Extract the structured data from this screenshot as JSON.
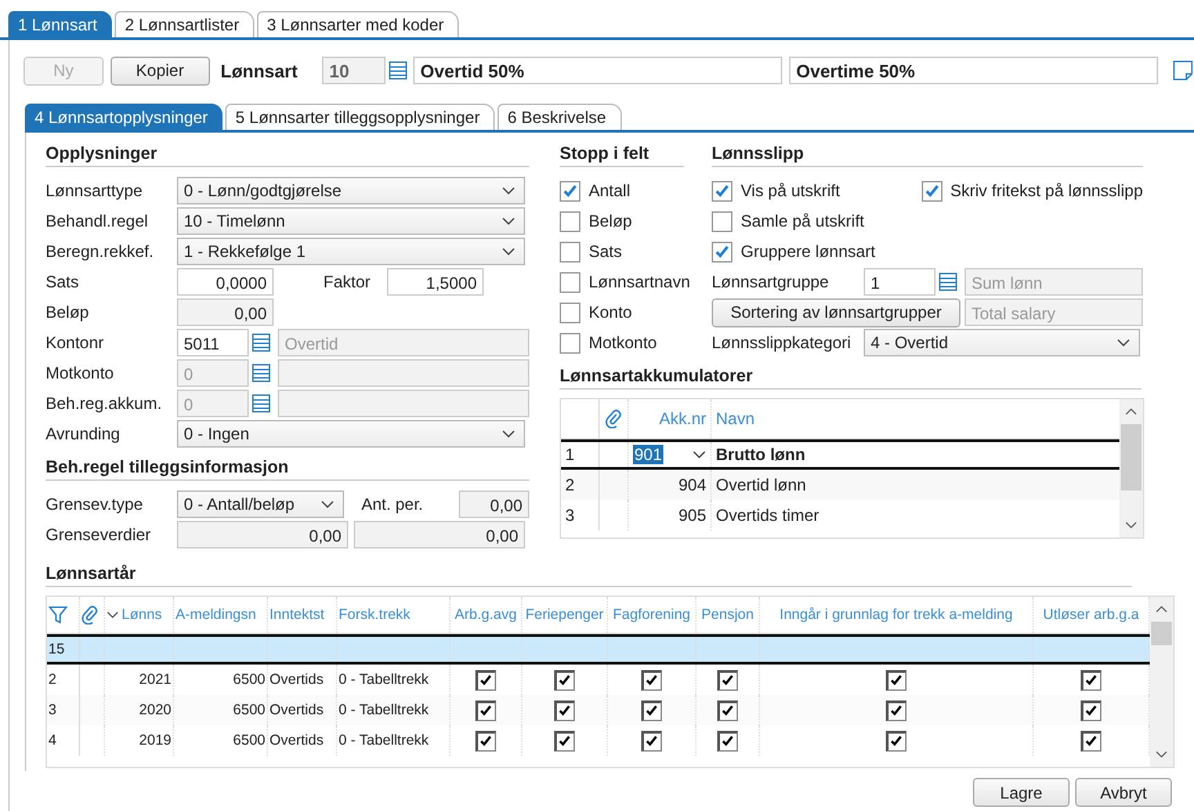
{
  "top_tabs": [
    {
      "label": "1 Lønnsart",
      "selected": true
    },
    {
      "label": "2 Lønnsartlister",
      "selected": false
    },
    {
      "label": "3 Lønnsarter med koder",
      "selected": false
    }
  ],
  "toolbar": {
    "buttons": [
      {
        "label": "Ny",
        "disabled": true
      },
      {
        "label": "Kopier",
        "disabled": false
      }
    ],
    "label": "Lønnsart",
    "code": "10",
    "name": "Overtid 50%",
    "name_en": "Overtime 50%"
  },
  "sub_tabs": [
    {
      "label": "4 Lønnsartopplysninger",
      "selected": true
    },
    {
      "label": "5 Lønnsarter tilleggsopplysninger",
      "selected": false
    },
    {
      "label": "6 Beskrivelse",
      "selected": false
    }
  ],
  "opplysninger": {
    "title": "Opplysninger",
    "fields": [
      {
        "kind": "select",
        "label": "Lønnsarttype",
        "value": "0 - Lønn/godtgjørelse"
      },
      {
        "kind": "select",
        "label": "Behandl.regel",
        "value": "10 - Timelønn"
      },
      {
        "kind": "select",
        "label": "Beregn.rekkef.",
        "value": "1 - Rekkefølge 1"
      },
      {
        "kind": "pair",
        "label": "Sats",
        "value": "0,0000",
        "label2": "Faktor",
        "value2": "1,5000"
      },
      {
        "kind": "number",
        "label": "Beløp",
        "value": "0,00",
        "disabled": true
      },
      {
        "kind": "lookup",
        "label": "Kontonr",
        "value": "5011",
        "description": "Overtid",
        "disabled": false
      },
      {
        "kind": "lookup",
        "label": "Motkonto",
        "value": "0",
        "disabled": true
      },
      {
        "kind": "lookup",
        "label": "Beh.reg.akkum.",
        "value": "0",
        "disabled": true
      },
      {
        "kind": "select",
        "label": "Avrunding",
        "value": "0 - Ingen"
      }
    ]
  },
  "tillegg": {
    "title": "Beh.regel tilleggsinformasjon",
    "type_label": "Grensev.type",
    "type_value": "0 - Antall/beløp",
    "per_label": "Ant. per.",
    "per_value": "0,00",
    "limits_label": "Grenseverdier",
    "limits": [
      "0,00",
      "0,00"
    ]
  },
  "stopp": {
    "title": "Stopp i felt",
    "items": [
      {
        "label": "Antall",
        "checked": true
      },
      {
        "label": "Beløp",
        "checked": false
      },
      {
        "label": "Sats",
        "checked": false
      },
      {
        "label": "Lønnsartnavn",
        "checked": false
      },
      {
        "label": "Konto",
        "checked": false
      },
      {
        "label": "Motkonto",
        "checked": false
      }
    ]
  },
  "lonnsslipp": {
    "title": "Lønnsslipp",
    "check_rows": [
      [
        {
          "label": "Vis på utskrift",
          "checked": true
        },
        {
          "label": "Skriv fritekst på lønnsslipp",
          "checked": true
        }
      ],
      [
        {
          "label": "Samle på utskrift",
          "checked": false
        }
      ],
      [
        {
          "label": "Gruppere lønnsart",
          "checked": true
        }
      ]
    ],
    "group_label": "Lønnsartgruppe",
    "group_value": "1",
    "group_description": "Sum lønn",
    "sort_button": "Sortering av lønnsartgrupper",
    "sort_description": "Total salary",
    "category_label": "Lønnsslippkategori",
    "category_value": "4 - Overtid"
  },
  "akkumulatorer": {
    "title": "Lønnsartakkumulatorer",
    "columns": [
      "Akk.nr",
      "Navn"
    ],
    "rows": [
      {
        "index": "1",
        "number": "901",
        "name": "Brutto lønn",
        "selected": true
      },
      {
        "index": "2",
        "number": "904",
        "name": "Overtid lønn",
        "selected": false
      },
      {
        "index": "3",
        "number": "905",
        "name": "Overtids timer",
        "selected": false
      }
    ]
  },
  "lonnsartar": {
    "title": "Lønnsartår",
    "columns": [
      "Lønns",
      "A-meldingsn",
      "Inntektst",
      "Forsk.trekk",
      "Arb.g.avg",
      "Feriepenger",
      "Fagforening",
      "Pensjon",
      "Inngår i grunnlag for trekk a-melding",
      "Utløser arb.g.a"
    ],
    "rows": [
      {
        "index": "15",
        "selected": true
      },
      {
        "index": "2",
        "selected": false,
        "year": "2021",
        "code": "6500",
        "income": "Overtids",
        "tax": "0 - Tabelltrekk",
        "flags": [
          true,
          true,
          true,
          true,
          true,
          true
        ]
      },
      {
        "index": "3",
        "selected": false,
        "year": "2020",
        "code": "6500",
        "income": "Overtids",
        "tax": "0 - Tabelltrekk",
        "flags": [
          true,
          true,
          true,
          true,
          true,
          true
        ]
      },
      {
        "index": "4",
        "selected": false,
        "year": "2019",
        "code": "6500",
        "income": "Overtids",
        "tax": "0 - Tabelltrekk",
        "flags": [
          true,
          true,
          true,
          true,
          true,
          true
        ]
      }
    ]
  },
  "footer_buttons": [
    "Lagre",
    "Avbryt"
  ]
}
